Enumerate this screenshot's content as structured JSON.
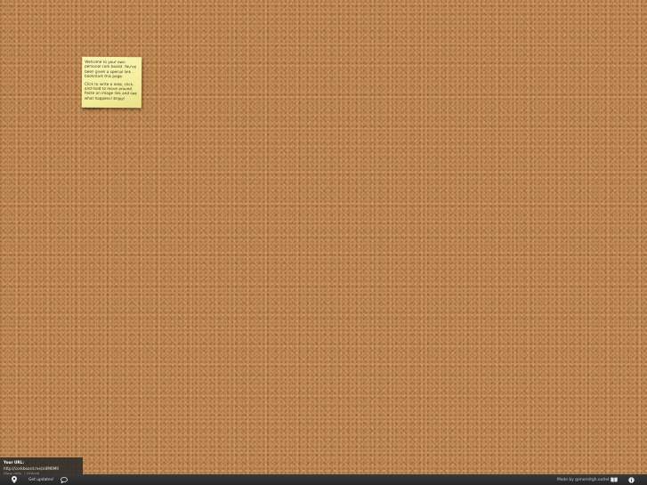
{
  "note": {
    "paragraph1": "Welcome to your own personal cork board. You've been given a special link - bookmark this page.",
    "paragraph2": "Click to write a note, click-and-hold to move around. Paste an image link and see what happens! Enjoy!"
  },
  "url_panel": {
    "label": "Your URL:",
    "url": "http://corkboard.me/zi4M6M9",
    "view_only": "View only",
    "unlock": "Unlock"
  },
  "bottom_bar": {
    "updates_label": "Get updates!",
    "made_by": "Made by @mornitgh.outlet"
  },
  "icons": {
    "pin": "location-pin-icon",
    "chat": "chat-bubble-icon",
    "book": "book-icon",
    "info": "info-icon"
  },
  "colors": {
    "cork": "#c08a55",
    "note": "#f6f0a5",
    "bar": "#2e2e2e"
  }
}
